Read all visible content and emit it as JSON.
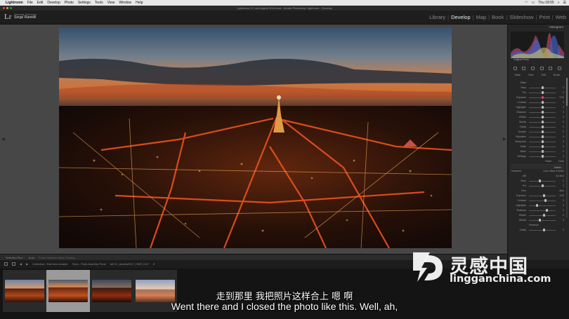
{
  "menubar": {
    "app_name": "Lightroom",
    "items": [
      "File",
      "Edit",
      "Develop",
      "Photo",
      "Settings",
      "Tools",
      "View",
      "Window",
      "Help"
    ],
    "clock": "Thu 18:55"
  },
  "window": {
    "title": "Lightroom CC cat August 2018.lrcat - Adobe Photoshop Lightroom - Develop"
  },
  "identity": {
    "logo": "Lr",
    "line1": "Serenity Orthodox",
    "name": "Serge Ramelli"
  },
  "modules": {
    "items": [
      "Library",
      "Develop",
      "Map",
      "Book",
      "Slideshow",
      "Print",
      "Web"
    ],
    "active": "Develop"
  },
  "right_panel": {
    "histogram_label": "Histogram",
    "original_photo_label": "Original Photo",
    "tabs": [
      "Mask",
      "New",
      "Edit",
      "Brush"
    ],
    "effect_label": "Effect",
    "sliders": [
      {
        "label": "Temp",
        "value": "0"
      },
      {
        "label": "Tint",
        "value": "0"
      },
      {
        "label": "Exposure",
        "value": "0.00"
      },
      {
        "label": "Contrast",
        "value": "0"
      },
      {
        "label": "Highlights",
        "value": "0"
      },
      {
        "label": "Shadows",
        "value": "0"
      },
      {
        "label": "Whites",
        "value": "0"
      },
      {
        "label": "Blacks",
        "value": "0"
      },
      {
        "label": "Clarity",
        "value": "0"
      },
      {
        "label": "Dehaze",
        "value": "0"
      },
      {
        "label": "Saturation",
        "value": "0"
      },
      {
        "label": "Sharpness",
        "value": "0"
      },
      {
        "label": "Noise",
        "value": "0"
      },
      {
        "label": "Moiré",
        "value": "0"
      },
      {
        "label": "Defringe",
        "value": "0"
      }
    ],
    "basic_label": "Basic",
    "basic_sub": [
      "Treatment",
      "Color",
      "Black & White"
    ],
    "basic_sliders": [
      {
        "label": "WB",
        "value": "As Shot"
      },
      {
        "label": "Temp",
        "value": "0"
      },
      {
        "label": "Tint",
        "value": "0"
      },
      {
        "label": "Tone",
        "value": "Auto"
      },
      {
        "label": "Exposure",
        "value": "0.00"
      },
      {
        "label": "Contrast",
        "value": "0"
      },
      {
        "label": "Highlights",
        "value": "0"
      },
      {
        "label": "Shadows",
        "value": "0"
      },
      {
        "label": "Whites",
        "value": "0"
      },
      {
        "label": "Blacks",
        "value": "0"
      },
      {
        "label": "Presence",
        "value": ""
      },
      {
        "label": "Clarity",
        "value": "0"
      },
      {
        "label": "Vibrance",
        "value": "0"
      }
    ],
    "close_label": "Close",
    "reset_label": "Reset"
  },
  "toolbar": {
    "selected_pins": "Selected Pins :",
    "pin_mode": "Auto",
    "show_overlay": "Show Selected Mask Overlay"
  },
  "filmbar": {
    "collection": "Collection : Bali new durable",
    "info": "Paris : Paris AutoSep Paris",
    "filename": "fall 01_Austria2017_HDR_0.87",
    "arrow": "▾"
  },
  "subtitles": {
    "chinese": "走到那里 我把照片这样合上 嗯 啊",
    "english": "Went there and I closed the photo like this. Well, ah,"
  },
  "watermark": {
    "cn": "灵感中国",
    "url": "lingganchina.com"
  },
  "colors": {
    "accent_slider": "#d04060",
    "workspace_bg": "#474747",
    "panel_bg": "#262626"
  }
}
